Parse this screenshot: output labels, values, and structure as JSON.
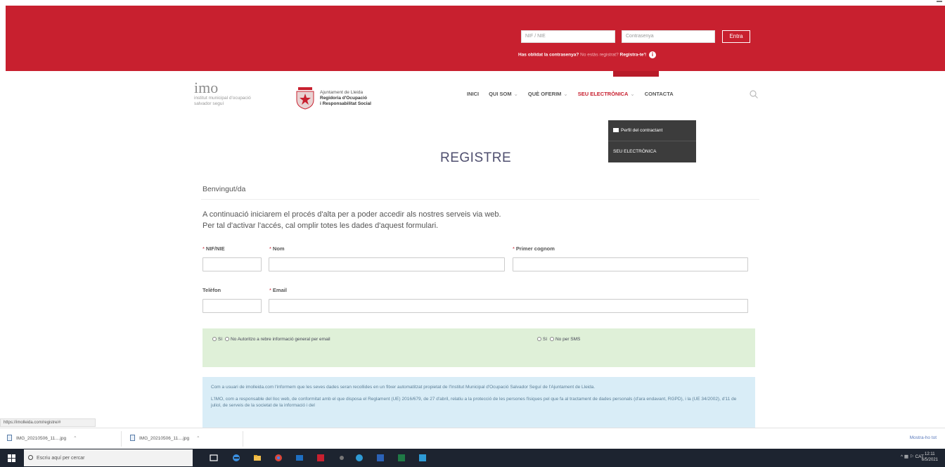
{
  "header": {
    "login": {
      "nif_placeholder": "NIF / NIE",
      "password_placeholder": "Contrasenya",
      "enter_label": "Entra",
      "forgot_label": "Has oblidat la contrasenya?",
      "not_registered_label": " No estàs registrat? ",
      "register_label": "Registra-te'!",
      "info_icon": "info-icon"
    }
  },
  "logos": {
    "imo_word": "imo",
    "imo_line1": "institut municipal d'ocupació",
    "imo_line2": "salvador seguí",
    "ajunt_line1": "Ajuntament de Lleida",
    "ajunt_line2": "Regidoria d'Ocupació",
    "ajunt_line3": "i Responsabilitat Social"
  },
  "nav": {
    "items": [
      {
        "label": "INICI",
        "caret": ""
      },
      {
        "label": "QUI SOM",
        "caret": "⌄"
      },
      {
        "label": "QUÈ OFERIM",
        "caret": "⌄"
      },
      {
        "label": "SEU ELECTRÒNICA",
        "caret": "⌄"
      },
      {
        "label": "CONTACTA",
        "caret": ""
      }
    ],
    "dropdown": [
      {
        "label": "Perfil del contractant"
      },
      {
        "label": "SEU ELECTRÒNICA"
      }
    ]
  },
  "page": {
    "title": "REGISTRE",
    "welcome": "Benvingut/da",
    "intro_line1": "A continuació iniciarem el procés d'alta per a poder accedir als nostres serveis via web.",
    "intro_line2": "Per tal d'activar l'accés, cal omplir totes les dades d'aquest formulari."
  },
  "form": {
    "required_mark": "*",
    "fields": {
      "nif": {
        "label": "NIF/NIE",
        "value": ""
      },
      "nom": {
        "label": "Nom",
        "value": ""
      },
      "cognom": {
        "label": "Primer cognom",
        "value": ""
      },
      "telefon": {
        "label": "Telèfon",
        "value": ""
      },
      "email": {
        "label": "Email",
        "value": ""
      }
    },
    "consent": {
      "yes": "Sí",
      "email_label": "No Autoritzo a rebre informació general per email",
      "sms_label": "No per SMS"
    },
    "privacy": {
      "para1": "Com a usuari de imolleida.com l'informem que les seves dades seran recollides en un fitxer automatitzat propietat de l'Institut Municipal d'Ocupació Salvador Seguí de l'Ajuntament de Lleida.",
      "para2": "L'IMO, com a responsable del lloc web, de conformitat amb el que disposa el Reglament (UE) 2016/679, de 27 d'abril, relatiu a la protecció de les persones físiques pel que fa al tractament de dades personals (d'ara endavant, RGPD), i la (UE 34/2002), d'11 de juliol, de serveis de la societat de la informació i del"
    }
  },
  "browser": {
    "status_url": "https://imolleida.com/registre/#",
    "downloads": [
      {
        "name": "IMG_20210506_11....jpg"
      },
      {
        "name": "IMG_20210506_11....jpg"
      }
    ],
    "show_all": "Mostra-ho tot"
  },
  "taskbar": {
    "search_placeholder": "Escriu aquí per cercar",
    "tray_text": "^  ▦ ⚐ CAT",
    "time": "12:11",
    "date": "6/5/2021"
  }
}
